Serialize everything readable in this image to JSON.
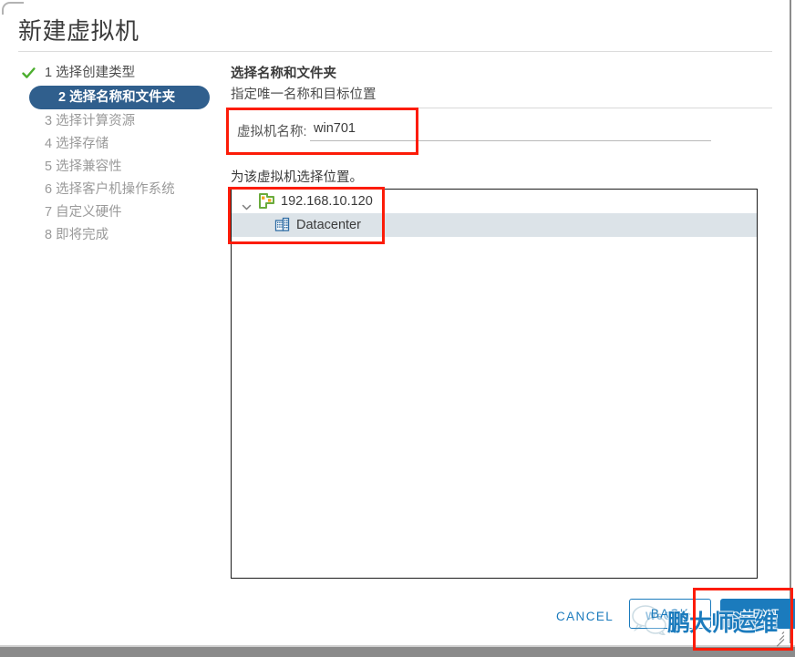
{
  "window": {
    "title": "新建虚拟机"
  },
  "steps": [
    {
      "num": "1",
      "label": "选择创建类型",
      "state": "done",
      "name": "step-select-creation-type"
    },
    {
      "num": "2",
      "label": "选择名称和文件夹",
      "state": "active",
      "name": "step-select-name-and-folder"
    },
    {
      "num": "3",
      "label": "选择计算资源",
      "state": "pending",
      "name": "step-select-compute-resource"
    },
    {
      "num": "4",
      "label": "选择存储",
      "state": "pending",
      "name": "step-select-storage"
    },
    {
      "num": "5",
      "label": "选择兼容性",
      "state": "pending",
      "name": "step-select-compatibility"
    },
    {
      "num": "6",
      "label": "选择客户机操作系统",
      "state": "pending",
      "name": "step-select-guest-os"
    },
    {
      "num": "7",
      "label": "自定义硬件",
      "state": "pending",
      "name": "step-customize-hardware"
    },
    {
      "num": "8",
      "label": "即将完成",
      "state": "pending",
      "name": "step-ready-to-complete"
    }
  ],
  "pane": {
    "title": "选择名称和文件夹",
    "subtitle": "指定唯一名称和目标位置",
    "name_label": "虚拟机名称:",
    "name_value": "win701",
    "name_placeholder": "",
    "location_label": "为该虚拟机选择位置。"
  },
  "tree": [
    {
      "label": "192.168.10.120",
      "icon": "vcenter-icon",
      "level": 1,
      "expanded": true,
      "selected": false
    },
    {
      "label": "Datacenter",
      "icon": "datacenter-icon",
      "level": 2,
      "expanded": false,
      "selected": true
    }
  ],
  "footer": {
    "cancel_label": "CANCEL",
    "back_label": "BACK",
    "next_label": "NEXT"
  },
  "watermark": {
    "text": "鹏大师运维",
    "caption": "WeChat"
  },
  "colors": {
    "accent": "#1b7bbd",
    "active_step_bg": "#305f8d",
    "annotation_red": "#fc1c08",
    "tree_selection": "#dce3e8",
    "check_green": "#4cae2e"
  }
}
